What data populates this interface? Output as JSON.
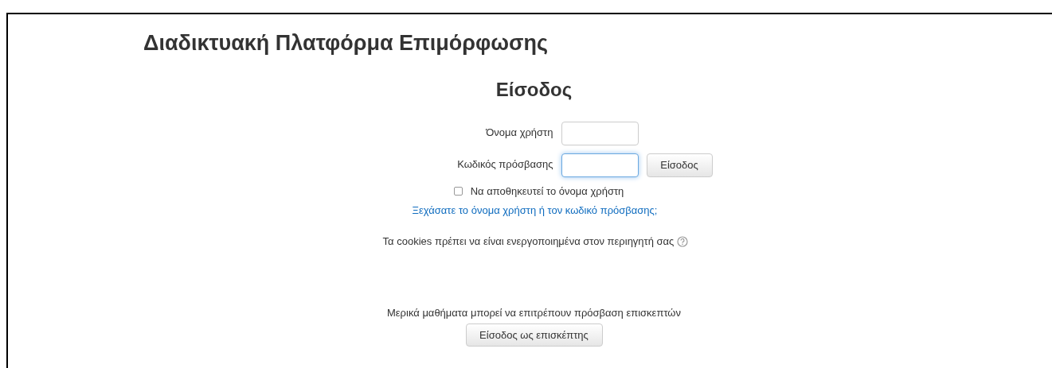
{
  "site_title": "Διαδικτυακή Πλατφόρμα Επιμόρφωσης",
  "heading": "Είσοδος",
  "fields": [
    {
      "label": "Όνομα χρήστη",
      "focused": false
    },
    {
      "label": "Κωδικός πρόσβασης",
      "focused": true
    }
  ],
  "login_button": "Είσοδος",
  "remember": {
    "label": "Να αποθηκευτεί το όνομα χρήστη",
    "checked": false
  },
  "forgot_link": "Ξεχάσατε το όνομα χρήστη ή τον κωδικό πρόσβασης;",
  "cookies_note": "Τα cookies πρέπει να είναι ενεργοποιημένα στον περιηγητή σας",
  "guest_note": "Μερικά μαθήματα μπορεί να επιτρέπουν πρόσβαση επισκεπτών",
  "guest_button": "Είσοδος ως επισκέπτης"
}
